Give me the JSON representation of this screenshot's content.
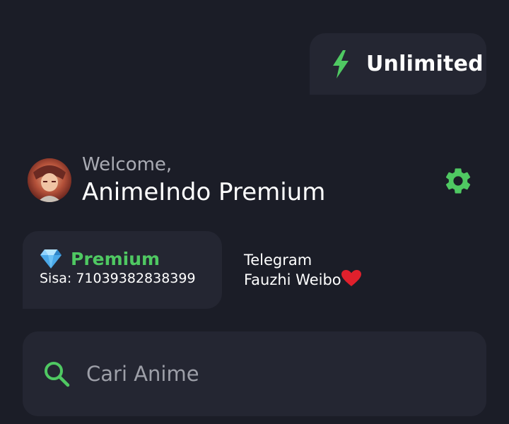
{
  "badge": {
    "label": "Unlimited",
    "icon": "lightning-bolt-icon"
  },
  "profile": {
    "greeting": "Welcome,",
    "username": "AnimeIndo Premium",
    "avatar": "avatar-image",
    "settings_icon": "gear-icon"
  },
  "premium": {
    "icon": "diamond-icon",
    "title": "Premium",
    "remaining": "Sisa: 71039382838399"
  },
  "credits": {
    "line1": "Telegram",
    "line2": "Fauzhi Weibo",
    "icon": "heart-icon"
  },
  "search": {
    "placeholder": "Cari Anime",
    "icon": "search-icon"
  },
  "colors": {
    "background": "#1b1d27",
    "card": "#242632",
    "accent": "#4fc862",
    "muted_text": "#a9abb3"
  }
}
